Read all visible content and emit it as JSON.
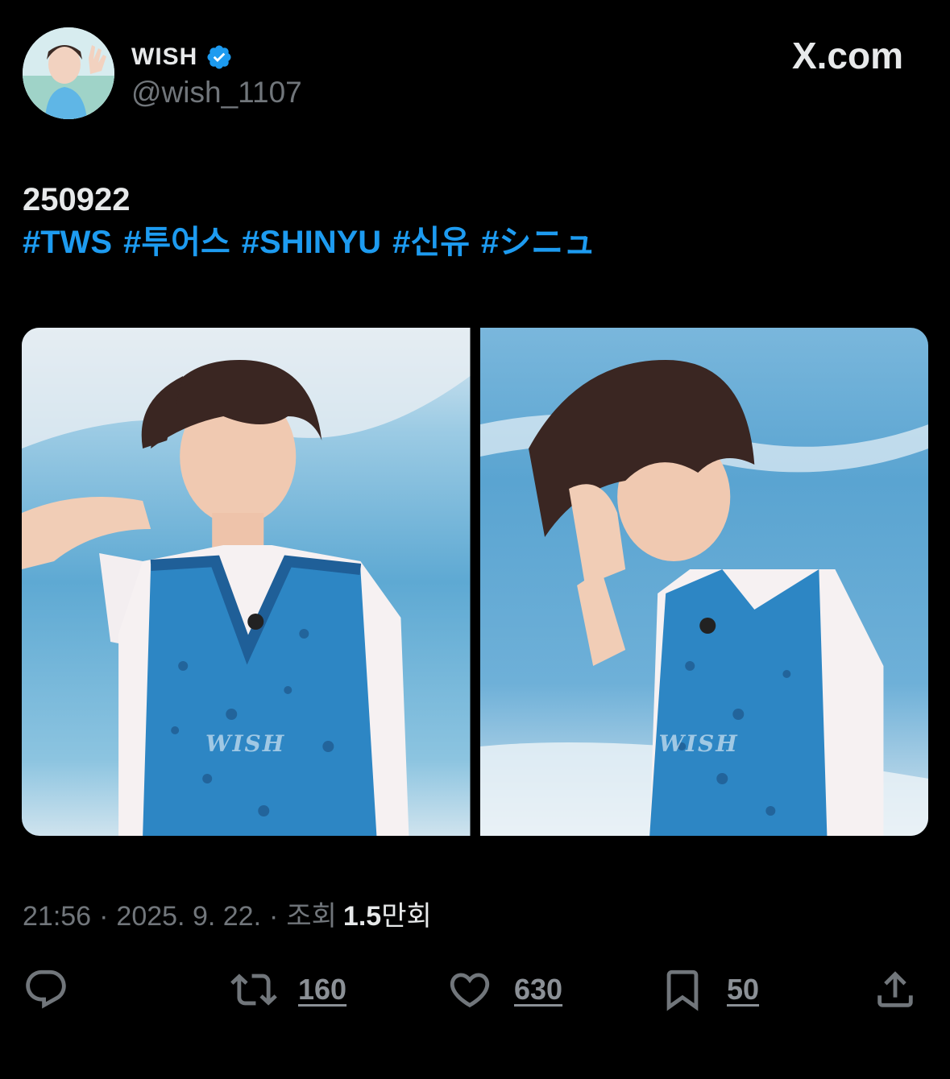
{
  "header": {
    "display_name": "WISH",
    "handle": "@wish_1107",
    "brand": "X.com"
  },
  "tweet": {
    "text": "250922",
    "hashtags": [
      "#TWS",
      "#투어스",
      "#SHINYU",
      "#신유",
      "#シニュ"
    ]
  },
  "media": {
    "watermark": "WISH"
  },
  "meta": {
    "time": "21:56",
    "sep1": "·",
    "date": "2025. 9. 22.",
    "sep2": "·",
    "views_label": "조회",
    "views_count": "1.5",
    "views_unit": "만회"
  },
  "actions": {
    "reply_count": "",
    "retweet_count": "160",
    "like_count": "630",
    "bookmark_count": "50"
  },
  "colors": {
    "accent": "#1d9bf0",
    "muted": "#71767b",
    "text": "#e7e9ea",
    "background": "#000000"
  },
  "icons": [
    "verified-badge-icon",
    "reply-icon",
    "retweet-icon",
    "like-icon",
    "bookmark-icon",
    "share-icon"
  ]
}
